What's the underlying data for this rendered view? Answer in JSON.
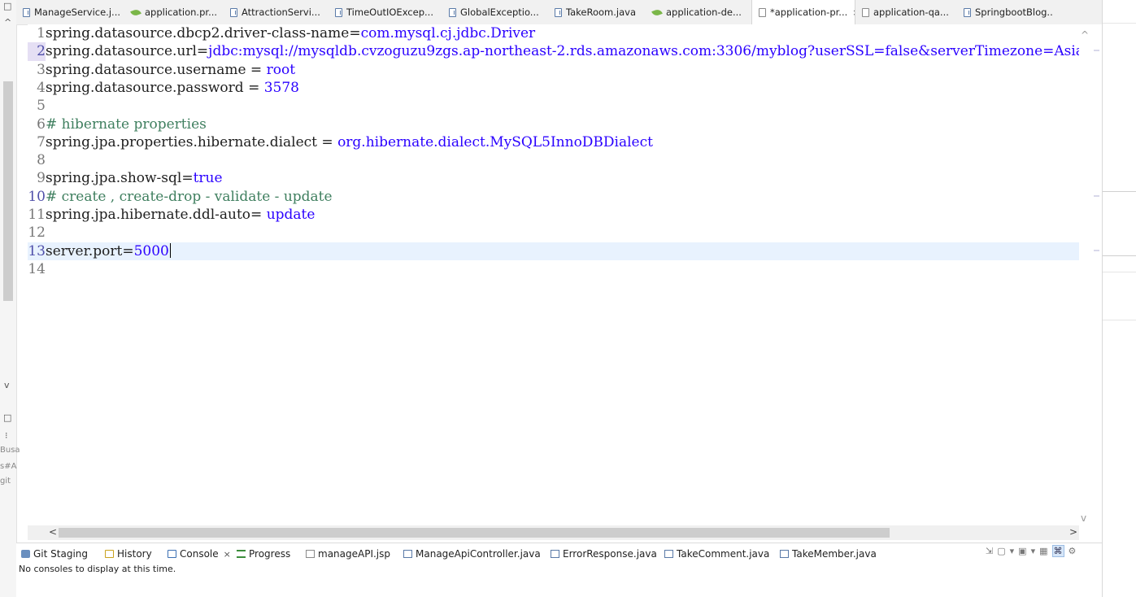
{
  "editor_tabs": [
    {
      "label": "ManageService.j...",
      "icon": "java-file-icon",
      "kind": "java"
    },
    {
      "label": "application.pr...",
      "icon": "spring-leaf-icon",
      "kind": "leaf"
    },
    {
      "label": "AttractionServi...",
      "icon": "java-file-icon",
      "kind": "java"
    },
    {
      "label": "TimeOutIOExcep...",
      "icon": "java-file-icon",
      "kind": "java"
    },
    {
      "label": "GlobalExceptio...",
      "icon": "java-file-icon",
      "kind": "java"
    },
    {
      "label": "TakeRoom.java",
      "icon": "java-file-icon",
      "kind": "java"
    },
    {
      "label": "application-de...",
      "icon": "spring-leaf-icon",
      "kind": "leaf"
    },
    {
      "label": "*application-pr...",
      "icon": "properties-file-icon",
      "kind": "prop",
      "active": true,
      "close": "×"
    },
    {
      "label": "application-qa...",
      "icon": "properties-file-icon",
      "kind": "prop"
    },
    {
      "label": "SpringbootBlog...",
      "icon": "java-file-icon",
      "kind": "java"
    }
  ],
  "editor": {
    "current_line": 13,
    "lines": [
      {
        "n": "1",
        "parts": [
          {
            "t": "spring.datasource.dbcp2.driver-class-name=",
            "c": "k"
          },
          {
            "t": "com.mysql.cj.jdbc.Driver",
            "c": "v"
          }
        ]
      },
      {
        "n": "2",
        "parts": [
          {
            "t": "spring.datasource.url=",
            "c": "k"
          },
          {
            "t": "jdbc:mysql://mysqldb.cvzoguzu9zgs.ap-northeast-2.rds.amazonaws.com:3306/myblog?userSSL=false&serverTimezone=Asia/Seo",
            "c": "v"
          }
        ],
        "num_style": "hlbg"
      },
      {
        "n": "3",
        "parts": [
          {
            "t": "spring.datasource.username = ",
            "c": "k"
          },
          {
            "t": "root",
            "c": "v"
          }
        ]
      },
      {
        "n": "4",
        "parts": [
          {
            "t": "spring.datasource.password = ",
            "c": "k"
          },
          {
            "t": "3578",
            "c": "v"
          }
        ]
      },
      {
        "n": "5",
        "parts": []
      },
      {
        "n": "6",
        "parts": [
          {
            "t": "# hibernate properties",
            "c": "c"
          }
        ]
      },
      {
        "n": "7",
        "parts": [
          {
            "t": "spring.jpa.properties.hibernate.dialect = ",
            "c": "k"
          },
          {
            "t": "org.hibernate.dialect.MySQL5InnoDBDialect",
            "c": "v"
          }
        ]
      },
      {
        "n": "8",
        "parts": []
      },
      {
        "n": "9",
        "parts": [
          {
            "t": "spring.jpa.show-sql=",
            "c": "k"
          },
          {
            "t": "true",
            "c": "v"
          }
        ]
      },
      {
        "n": "10",
        "parts": [
          {
            "t": "# create , create-drop - validate - update",
            "c": "c"
          }
        ],
        "num_style": "hl"
      },
      {
        "n": "11",
        "parts": [
          {
            "t": "spring.jpa.hibernate.ddl-auto= ",
            "c": "k"
          },
          {
            "t": "update",
            "c": "v"
          }
        ]
      },
      {
        "n": "12",
        "parts": []
      },
      {
        "n": "13",
        "parts": [
          {
            "t": "server.port=",
            "c": "k"
          },
          {
            "t": "5000",
            "c": "v"
          }
        ],
        "num_style": "hl",
        "caret": true
      },
      {
        "n": "14",
        "parts": []
      }
    ]
  },
  "bottom_tabs": [
    {
      "label": "Git Staging",
      "icon": "git-staging-icon",
      "cls": "bi-git"
    },
    {
      "label": "History",
      "icon": "history-icon",
      "cls": "bi-hist"
    },
    {
      "label": "Console",
      "icon": "console-icon",
      "cls": "bi-console",
      "active": true,
      "close": "×"
    },
    {
      "label": "Progress",
      "icon": "progress-icon",
      "cls": "bi-prog"
    },
    {
      "label": "manageAPI.jsp",
      "icon": "jsp-file-icon",
      "cls": "bi-jsp"
    },
    {
      "label": "ManageApiController.java",
      "icon": "java-file-icon",
      "cls": "bi-java"
    },
    {
      "label": "ErrorResponse.java",
      "icon": "java-file-icon",
      "cls": "bi-java"
    },
    {
      "label": "TakeComment.java",
      "icon": "java-file-icon",
      "cls": "bi-java"
    },
    {
      "label": "TakeMember.java",
      "icon": "java-file-icon",
      "cls": "bi-java"
    }
  ],
  "console": {
    "message": "No consoles to display at this time."
  },
  "left_strip": {
    "texts": [
      "Busa",
      "s#A",
      "git"
    ],
    "up": "^",
    "down": "v",
    "box1": "□",
    "box2": "□",
    "dots": "⁝"
  },
  "scroll": {
    "left": "<",
    "right": ">",
    "up": "^",
    "down": "v"
  },
  "toolbar": {
    "icons": [
      "⇲",
      "▢",
      "▾",
      "▣",
      "▾",
      "▦",
      "⌘",
      "⚙"
    ]
  }
}
